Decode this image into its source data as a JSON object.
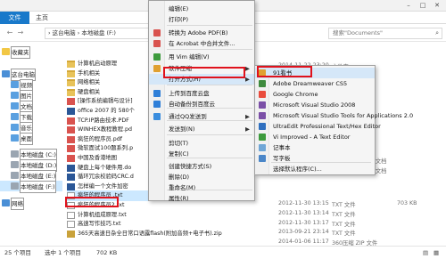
{
  "ribbon": {
    "file_tab": "文件",
    "home_tab": "主页"
  },
  "address": {
    "back_arrow": "←",
    "forward_arrow": "→",
    "path": "› 这台电脑 › 本地磁盘 (F:)",
    "search_placeholder": "搜索\"Documents\""
  },
  "leftnav": {
    "items": [
      {
        "label": "收藏夹",
        "icon": "star-icon",
        "color": "#f2c744"
      },
      {
        "label": "这台电脑",
        "icon": "computer-icon",
        "color": "#4a8fd6"
      },
      {
        "label": "视频",
        "icon": "video-folder-icon",
        "color": "#5aa0e0"
      },
      {
        "label": "图片",
        "icon": "pictures-folder-icon",
        "color": "#5aa0e0"
      },
      {
        "label": "文档",
        "icon": "documents-folder-icon",
        "color": "#5aa0e0"
      },
      {
        "label": "下载",
        "icon": "downloads-folder-icon",
        "color": "#5aa0e0"
      },
      {
        "label": "音乐",
        "icon": "music-folder-icon",
        "color": "#5aa0e0"
      },
      {
        "label": "桌面",
        "icon": "desktop-folder-icon",
        "color": "#5aa0e0"
      },
      {
        "label": "本地磁盘 (C:)",
        "icon": "drive-icon",
        "color": "#9aa5b1"
      },
      {
        "label": "本地磁盘 (D:)",
        "icon": "drive-icon",
        "color": "#9aa5b1"
      },
      {
        "label": "本地磁盘 (E:)",
        "icon": "drive-icon",
        "color": "#9aa5b1"
      },
      {
        "label": "本地磁盘 (F:)",
        "icon": "drive-icon",
        "color": "#9aa5b1"
      },
      {
        "label": "网络",
        "icon": "network-icon",
        "color": "#4a8fd6"
      }
    ]
  },
  "files": [
    {
      "name": "计算机启动原理",
      "icon": "folder"
    },
    {
      "name": "手机相关",
      "icon": "folder"
    },
    {
      "name": "网络相关",
      "icon": "folder"
    },
    {
      "name": "硬盘相关",
      "icon": "folder"
    },
    {
      "name": "[操作系统编辑与设计]",
      "icon": "pdf"
    },
    {
      "name": "office 2007 的 580个",
      "icon": "word"
    },
    {
      "name": "TCP.IP路由技术.PDF",
      "icon": "pdf"
    },
    {
      "name": "WINHEX教程教程.pd",
      "icon": "pdf"
    },
    {
      "name": "疯狂的程序员.pdf",
      "icon": "pdf"
    },
    {
      "name": "微软面试100题系列.p",
      "icon": "pdf"
    },
    {
      "name": "中国及香港地图",
      "icon": "pdf"
    },
    {
      "name": "硬盘上每个硬件用.do",
      "icon": "word"
    },
    {
      "name": "循环冗余校验码CRC.d",
      "icon": "word"
    },
    {
      "name": "怎样编一个文件加密",
      "icon": "word"
    },
    {
      "name": "疯狂的程序员 .txt",
      "icon": "txt"
    },
    {
      "name": "疯狂的程序员2.txt",
      "icon": "txt"
    },
    {
      "name": "计算机组成原理.txt",
      "icon": "txt"
    },
    {
      "name": "高速写作技巧.txt",
      "icon": "txt"
    },
    {
      "name": "365天高速日杂全日常口语露flash(附加音频+电子书).zip",
      "icon": "zip"
    }
  ],
  "file_details": [
    {
      "date": "2014-11-22 23:20",
      "type": "文件夹"
    },
    {
      "date": "2014-11-05 20:29",
      "type": "Microsoft Word 文档"
    },
    {
      "date": "2014-11-05 20:24",
      "type": "Microsoft Word 文档"
    },
    {
      "date": "2012-11-30 13:15",
      "type": "TXT 文件",
      "size": "703 KB"
    },
    {
      "date": "2012-11-30 13:14",
      "type": "TXT 文件"
    },
    {
      "date": "2012-11-30 13:17",
      "type": "TXT 文件"
    },
    {
      "date": "2013-09-21 23:14",
      "type": "TXT 文件"
    },
    {
      "date": "2014-01-06 11:17",
      "type": "360压缩 ZIP 文件"
    }
  ],
  "context_menu": {
    "items": [
      {
        "label": "编辑(E)",
        "icon": ""
      },
      {
        "label": "打印(P)",
        "icon": ""
      },
      {
        "label": "转换为 Adobe PDF(B)",
        "icon": "pdf-icon",
        "color": "#d9534f"
      },
      {
        "label": "在 Acrobat 中合并文件...",
        "icon": "acrobat-icon",
        "color": "#d9534f"
      },
      {
        "label": "用 Vim 编辑(V)",
        "icon": "vim-icon",
        "color": "#3c9a3c"
      },
      {
        "label": "软件压缩",
        "icon": "compress-icon",
        "color": "#e0a030"
      },
      {
        "label": "打开方式(H)",
        "icon": "",
        "arrow": "▶"
      },
      {
        "label": "上传到百度云盘",
        "icon": "cloud-icon",
        "color": "#2f7fd8"
      },
      {
        "label": "自动备份到百度云",
        "icon": "cloud-backup-icon",
        "color": "#2f7fd8"
      },
      {
        "label": "通过QQ发送到",
        "icon": "qq-icon",
        "color": "#3a8dde"
      },
      {
        "label": "发送到(N)",
        "icon": ""
      },
      {
        "label": "剪切(T)",
        "icon": ""
      },
      {
        "label": "复制(C)",
        "icon": ""
      },
      {
        "label": "创建快捷方式(S)",
        "icon": ""
      },
      {
        "label": "删除(D)",
        "icon": ""
      },
      {
        "label": "重命名(M)",
        "icon": ""
      },
      {
        "label": "属性(R)",
        "icon": ""
      }
    ],
    "arrow": "▶"
  },
  "submenu": {
    "items": [
      {
        "label": "91看书",
        "icon": "reader-icon",
        "color": "#e0a030"
      },
      {
        "label": "Adobe Dreamweaver CS5",
        "icon": "dreamweaver-icon",
        "color": "#3d8a3d"
      },
      {
        "label": "Google Chrome",
        "icon": "chrome-icon",
        "color": "#e94b3c"
      },
      {
        "label": "Microsoft Visual Studio 2008",
        "icon": "visual-studio-icon",
        "color": "#7a4ea6"
      },
      {
        "label": "Microsoft Visual Studio Tools for Applications 2.0",
        "icon": "visual-studio-icon",
        "color": "#7a4ea6"
      },
      {
        "label": "UltraEdit Professional Text/Hex Editor",
        "icon": "ultraedit-icon",
        "color": "#2f6fbf"
      },
      {
        "label": "Vi Improved - A Text Editor",
        "icon": "vim-icon",
        "color": "#3c9a3c"
      },
      {
        "label": "记事本",
        "icon": "notepad-icon",
        "color": "#6fa6d6"
      },
      {
        "label": "写字板",
        "icon": "wordpad-icon",
        "color": "#4a86c8"
      },
      {
        "label": "选择默认程序(C)...",
        "icon": ""
      }
    ]
  },
  "status": {
    "count": "25 个项目",
    "selected": "选中 1 个项目",
    "size": "702 KB"
  }
}
